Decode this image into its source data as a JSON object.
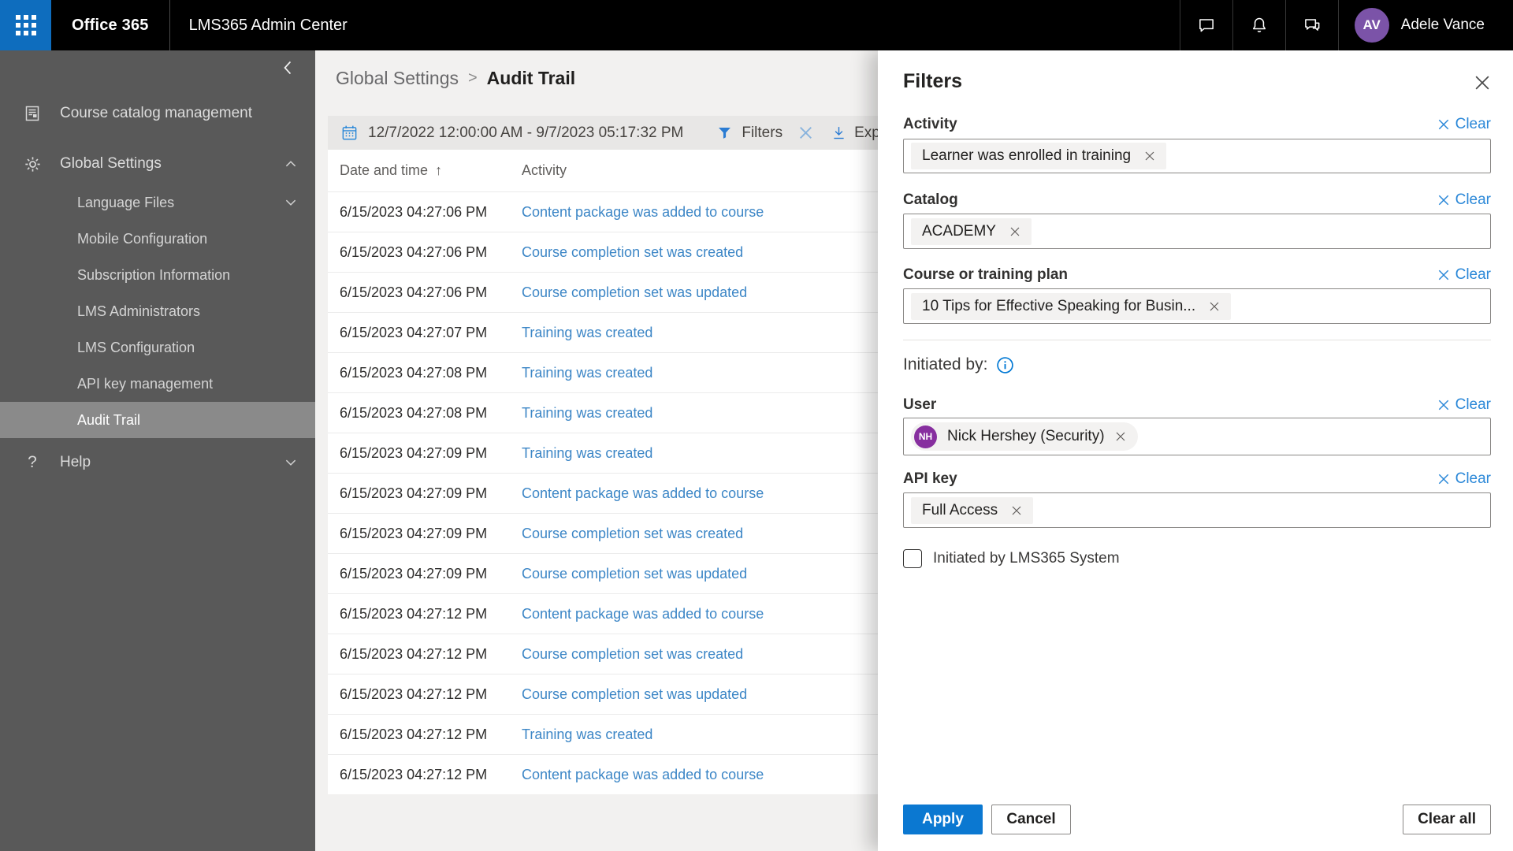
{
  "topbar": {
    "brand": "Office 365",
    "app_title": "LMS365 Admin Center",
    "user_initials": "AV",
    "user_name": "Adele Vance"
  },
  "sidebar": {
    "course_catalog": "Course catalog management",
    "global_settings": "Global Settings",
    "sub_items": [
      "Language Files",
      "Mobile Configuration",
      "Subscription Information",
      "LMS Administrators",
      "LMS Configuration",
      "API key management",
      "Audit Trail"
    ],
    "help": "Help",
    "help_glyph": "?"
  },
  "breadcrumb": {
    "parent": "Global Settings",
    "separator": ">",
    "current": "Audit Trail"
  },
  "toolbar": {
    "date_range": "12/7/2022 12:00:00 AM - 9/7/2023 05:17:32 PM",
    "filters_label": "Filters",
    "export_label": "Export"
  },
  "table": {
    "col_date": "Date and time",
    "sort_glyph": "↑",
    "col_activity": "Activity",
    "rows": [
      {
        "date": "6/15/2023 04:27:06 PM",
        "activity": "Content package was added to course"
      },
      {
        "date": "6/15/2023 04:27:06 PM",
        "activity": "Course completion set was created"
      },
      {
        "date": "6/15/2023 04:27:06 PM",
        "activity": "Course completion set was updated"
      },
      {
        "date": "6/15/2023 04:27:07 PM",
        "activity": "Training was created"
      },
      {
        "date": "6/15/2023 04:27:08 PM",
        "activity": "Training was created"
      },
      {
        "date": "6/15/2023 04:27:08 PM",
        "activity": "Training was created"
      },
      {
        "date": "6/15/2023 04:27:09 PM",
        "activity": "Training was created"
      },
      {
        "date": "6/15/2023 04:27:09 PM",
        "activity": "Content package was added to course"
      },
      {
        "date": "6/15/2023 04:27:09 PM",
        "activity": "Course completion set was created"
      },
      {
        "date": "6/15/2023 04:27:09 PM",
        "activity": "Course completion set was updated"
      },
      {
        "date": "6/15/2023 04:27:12 PM",
        "activity": "Content package was added to course"
      },
      {
        "date": "6/15/2023 04:27:12 PM",
        "activity": "Course completion set was created"
      },
      {
        "date": "6/15/2023 04:27:12 PM",
        "activity": "Course completion set was updated"
      },
      {
        "date": "6/15/2023 04:27:12 PM",
        "activity": "Training was created"
      },
      {
        "date": "6/15/2023 04:27:12 PM",
        "activity": "Content package was added to course"
      }
    ]
  },
  "filters": {
    "title": "Filters",
    "clear_label": "Clear",
    "activity": {
      "label": "Activity",
      "chip": "Learner was enrolled in training"
    },
    "catalog": {
      "label": "Catalog",
      "chip": "ACADEMY"
    },
    "course": {
      "label": "Course or training plan",
      "chip": "10 Tips for Effective Speaking for Busin..."
    },
    "initiated_by": "Initiated by:",
    "user": {
      "label": "User",
      "chip": "Nick Hershey (Security)",
      "initials": "NH"
    },
    "api_key": {
      "label": "API key",
      "chip": "Full Access"
    },
    "checkbox_label": "Initiated by LMS365 System",
    "apply": "Apply",
    "cancel": "Cancel",
    "clear_all": "Clear all"
  },
  "colors": {
    "accent_blue": "#0b78d1",
    "link_blue": "#3c86c6",
    "clear_link_blue": "#2b88d8",
    "topbar_black": "#000000",
    "waffle_blue": "#0e6dbe",
    "sidebar_gray": "#595959",
    "sidebar_selected": "#8a8a8a",
    "avatar_user_purple": "#7b53a8",
    "avatar_chip_purple": "#872f9f"
  }
}
